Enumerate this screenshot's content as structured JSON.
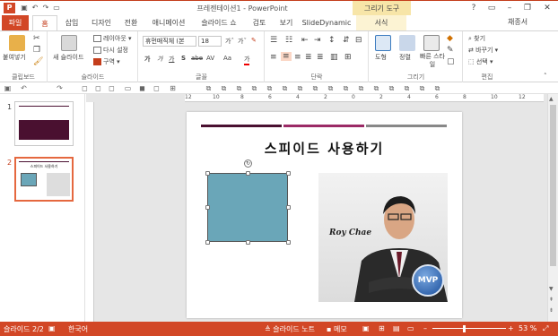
{
  "app": {
    "doc_title": "프레젠테이션1 - PowerPoint",
    "contextual_tab_group": "그리기 도구",
    "user_name": "채종서",
    "logo_letter": "P"
  },
  "tabs": [
    "파일",
    "홈",
    "삽입",
    "디자인",
    "전환",
    "애니메이션",
    "슬라이드 쇼",
    "검토",
    "보기",
    "SlideDynamic",
    "서식"
  ],
  "ribbon": {
    "clipboard": {
      "label": "클립보드",
      "paste": "붙여넣기"
    },
    "slides": {
      "label": "슬라이드",
      "new_slide": "새 슬라이드",
      "layout": "레이아웃",
      "reset": "다시 설정",
      "section": "구역"
    },
    "font": {
      "label": "글꼴",
      "font_name": "휴먼매직체 (본",
      "font_size": "18",
      "bold": "가",
      "italic": "가",
      "underline": "가",
      "strike": "S",
      "shadow": "abe",
      "spacing": "AV",
      "case": "Aa",
      "color": "가"
    },
    "paragraph": {
      "label": "단락"
    },
    "drawing": {
      "label": "그리기",
      "shapes": "도형",
      "arrange": "정렬",
      "quick_styles": "빠른 스타일"
    },
    "editing": {
      "label": "편집",
      "find": "찾기",
      "replace": "바꾸기",
      "select": "선택"
    }
  },
  "slides": [
    {
      "num": "1",
      "selected": false
    },
    {
      "num": "2",
      "selected": true,
      "thumb_title": "스피이드 사용하기"
    }
  ],
  "slide": {
    "title": "스피이드 사용하기",
    "photo_caption": "Roy Chae",
    "badge": "MVP",
    "bar_colors": [
      "#4a1030",
      "#9b2a66",
      "#888888"
    ],
    "shape_color": "#6aa6b8"
  },
  "ruler": {
    "h_labels": [
      "12",
      "10",
      "8",
      "6",
      "4",
      "2",
      "0",
      "2",
      "4",
      "6",
      "8",
      "10",
      "12"
    ]
  },
  "status": {
    "slide_counter": "슬라이드 2/2",
    "language": "한국어",
    "notes": "슬라이드 노트",
    "comments": "메모",
    "zoom": "53 %"
  },
  "colors": {
    "accent": "#d24726",
    "context": "#f7e5a8"
  }
}
